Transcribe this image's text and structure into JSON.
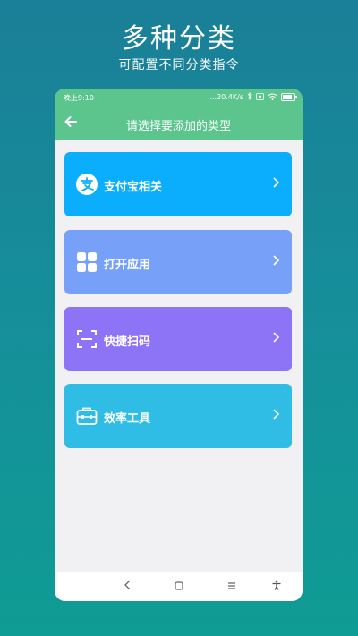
{
  "headline": {
    "title": "多种分类",
    "subtitle": "可配置不同分类指令"
  },
  "status": {
    "time": "晚上9:10",
    "speed": "...20.4K/s",
    "battery_level": 0.85
  },
  "toolbar": {
    "title": "请选择要添加的类型",
    "back_icon": "arrow-left-icon"
  },
  "categories": [
    {
      "label": "支付宝相关",
      "icon": "alipay-icon",
      "color": "#0aaefc"
    },
    {
      "label": "打开应用",
      "icon": "app-grid-icon",
      "color": "#77a1f8"
    },
    {
      "label": "快捷扫码",
      "icon": "scan-icon",
      "color": "#8d73f6"
    },
    {
      "label": "效率工具",
      "icon": "toolbox-icon",
      "color": "#30bde5"
    }
  ],
  "colors": {
    "header": "#5cc58d",
    "content_bg": "#f1f1f3"
  },
  "navbar": [
    "back-nav-icon",
    "home-nav-icon",
    "menu-nav-icon",
    "accessibility-icon"
  ]
}
